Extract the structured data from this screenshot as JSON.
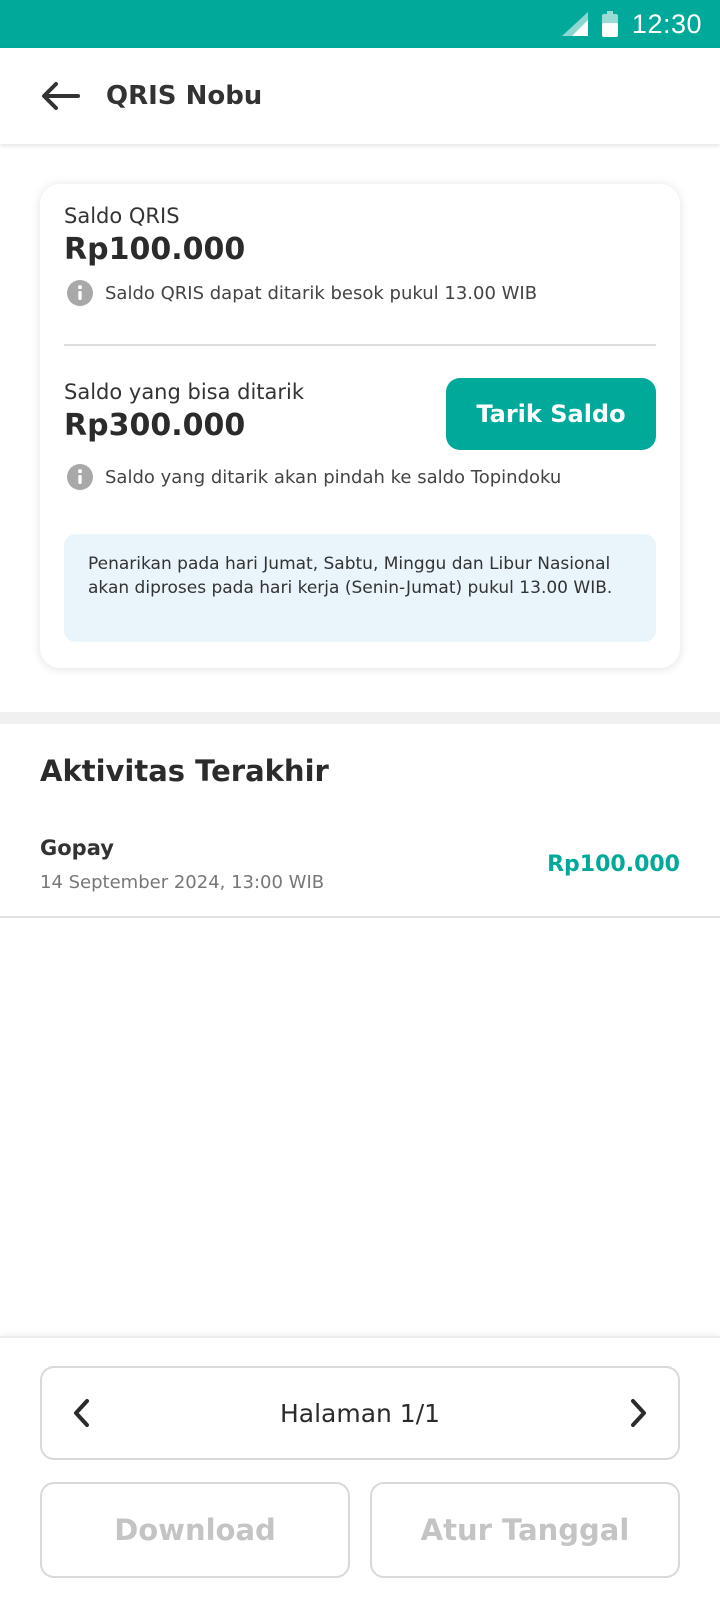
{
  "status_bar": {
    "time": "12:30",
    "icons": [
      "signal-icon",
      "battery-icon"
    ]
  },
  "app_bar": {
    "title": "QRIS Nobu",
    "back_icon": "arrow-left-icon"
  },
  "balance_card": {
    "qris_label": "Saldo QRIS",
    "qris_amount": "Rp100.000",
    "qris_info": "Saldo QRIS dapat ditarik besok pukul 13.00 WIB",
    "withdrawable_label": "Saldo yang bisa ditarik",
    "withdrawable_amount": "Rp300.000",
    "withdraw_button": "Tarik Saldo",
    "withdraw_info": "Saldo yang ditarik akan pindah ke saldo Topindoku",
    "notice": "Penarikan pada hari Jumat, Sabtu, Minggu dan Libur Nasional akan diproses pada hari kerja (Senin-Jumat) pukul 13.00 WIB."
  },
  "activity": {
    "title": "Aktivitas Terakhir",
    "items": [
      {
        "name": "Gopay",
        "date": "14 September 2024, 13:00 WIB",
        "amount": "Rp100.000"
      }
    ]
  },
  "pagination": {
    "label": "Halaman 1/1",
    "prev_icon": "chevron-left-icon",
    "next_icon": "chevron-right-icon"
  },
  "actions": {
    "download_label": "Download",
    "date_filter_label": "Atur Tanggal"
  },
  "colors": {
    "primary": "#00a99a",
    "notice_bg": "#e9f4fb",
    "disabled_text": "#c4c4c4"
  }
}
